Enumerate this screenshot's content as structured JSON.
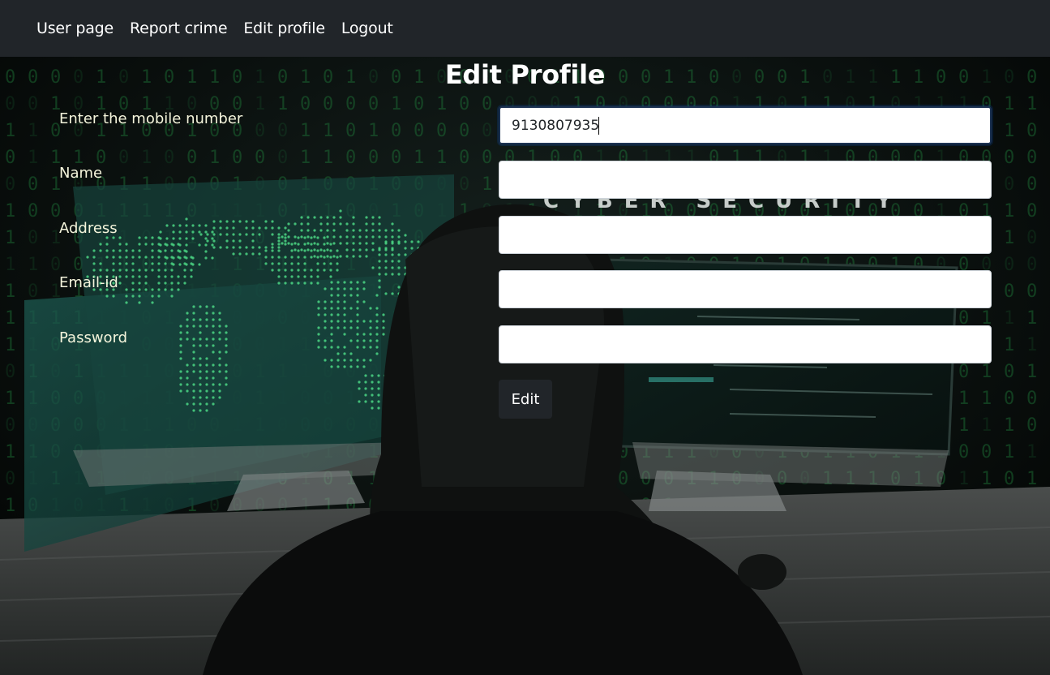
{
  "nav": {
    "items": [
      {
        "label": "User page"
      },
      {
        "label": "Report crime"
      },
      {
        "label": "Edit profile"
      },
      {
        "label": "Logout"
      }
    ]
  },
  "page": {
    "title": "Edit Profile"
  },
  "form": {
    "mobile": {
      "label": "Enter the mobile number",
      "value": "9130807935"
    },
    "name": {
      "label": "Name",
      "value": ""
    },
    "address": {
      "label": "Address",
      "value": ""
    },
    "email": {
      "label": "Email-id",
      "value": ""
    },
    "password": {
      "label": "Password",
      "value": ""
    },
    "submit_label": "Edit"
  },
  "background": {
    "banner_text": "CYBER SECURITY"
  },
  "colors": {
    "navbar": "#212529",
    "label_text": "#f5f5dc",
    "button": "#212529",
    "matrix_green": "#1f7a3a"
  }
}
